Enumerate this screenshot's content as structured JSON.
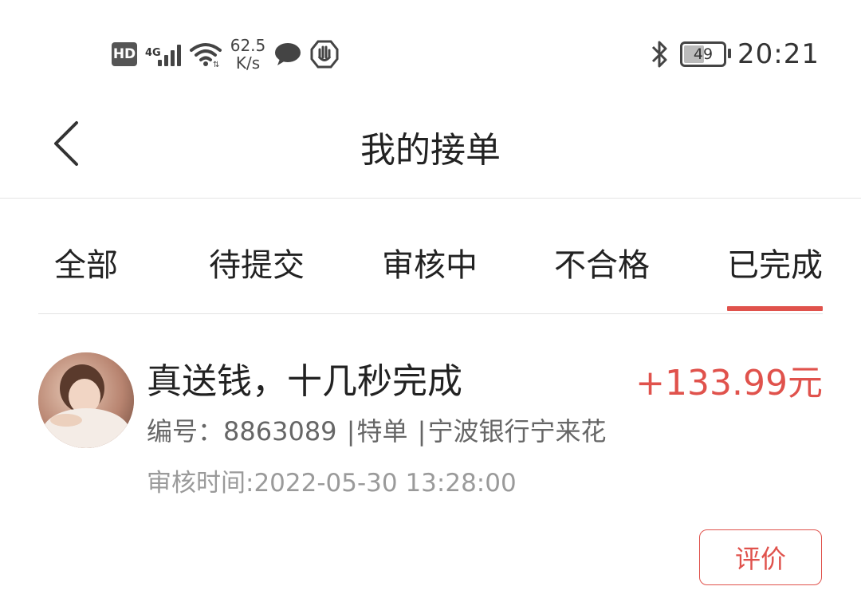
{
  "status_bar": {
    "hd_badge": "HD",
    "network_type": "4G",
    "speed_value": "62.5",
    "speed_unit": "K/s",
    "battery_level": "49",
    "time": "20:21",
    "icons": [
      "hd-icon",
      "signal-icon",
      "wifi-icon",
      "chat-icon",
      "shield-hand-icon",
      "bluetooth-icon",
      "battery-icon"
    ]
  },
  "header": {
    "back_icon": "chevron-left-icon",
    "title": "我的接单"
  },
  "tabs": [
    {
      "label": "全部",
      "active": false
    },
    {
      "label": "待提交",
      "active": false
    },
    {
      "label": "审核中",
      "active": false
    },
    {
      "label": "不合格",
      "active": false
    },
    {
      "label": "已完成",
      "active": true
    }
  ],
  "colors": {
    "accent": "#e0524c",
    "text_primary": "#222222",
    "text_secondary": "#666666",
    "text_muted": "#9a9a9a",
    "divider": "#e3e3e3"
  },
  "order": {
    "title": "真送钱，十几秒完成",
    "amount": "+133.99元",
    "id_label": "编号：",
    "id_value": "8863089",
    "type": "特单",
    "bank": "宁波银行宁来花",
    "separator": "|",
    "review_time": "审核时间:2022-05-30 13:28:00",
    "review_button": "评价"
  }
}
